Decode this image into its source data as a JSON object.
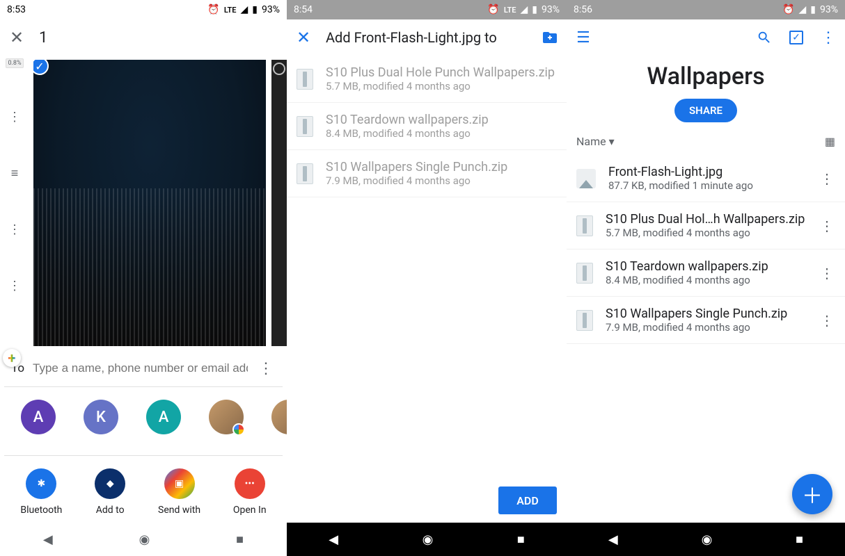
{
  "panel1": {
    "status": {
      "time": "8:53",
      "lte": "LTE",
      "battery": "93%"
    },
    "title": "1",
    "zoom": "0.8%",
    "to_label": "To",
    "to_placeholder": "Type a name, phone number or email address",
    "contacts": [
      {
        "initial": "A"
      },
      {
        "initial": "K"
      },
      {
        "initial": "A"
      }
    ],
    "share_targets": {
      "bluetooth": "Bluetooth",
      "addto": "Add to",
      "sendwith": "Send with",
      "openin": "Open In"
    }
  },
  "panel2": {
    "status": {
      "time": "8:54",
      "lte": "LTE",
      "battery": "93%"
    },
    "title": "Add Front-Flash-Light.jpg to",
    "files": [
      {
        "name": "S10 Plus Dual Hole Punch Wallpapers.zip",
        "meta": "5.7 MB, modified 4 months ago"
      },
      {
        "name": "S10 Teardown wallpapers.zip",
        "meta": "8.4 MB, modified 4 months ago"
      },
      {
        "name": "S10 Wallpapers Single Punch.zip",
        "meta": "7.9 MB, modified 4 months ago"
      }
    ],
    "add_label": "ADD"
  },
  "panel3": {
    "status": {
      "time": "8:56",
      "battery": "93%"
    },
    "folder_title": "Wallpapers",
    "share_label": "SHARE",
    "sort_label": "Name",
    "files": [
      {
        "name": "Front-Flash-Light.jpg",
        "meta": "87.7 KB, modified 1 minute ago",
        "icon": "image"
      },
      {
        "name": "S10 Plus Dual Hol…h Wallpapers.zip",
        "meta": "5.7 MB, modified 4 months ago",
        "icon": "zip"
      },
      {
        "name": "S10 Teardown wallpapers.zip",
        "meta": "8.4 MB, modified 4 months ago",
        "icon": "zip"
      },
      {
        "name": "S10 Wallpapers Single Punch.zip",
        "meta": "7.9 MB, modified 4 months ago",
        "icon": "zip"
      }
    ]
  }
}
